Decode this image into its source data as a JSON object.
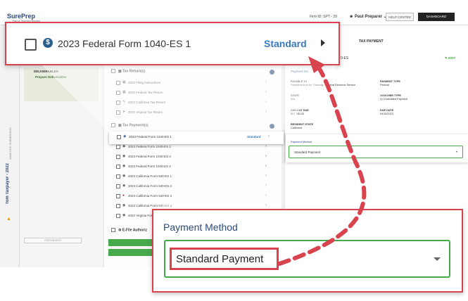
{
  "app": {
    "logo": "SurePrep",
    "logo_sub": "Part of Thomson Reuters",
    "firm_id": "Firm ID: SPT - 29",
    "user_name": "Paul Preparer",
    "help_center": "HELP CENTER",
    "dashboard": "DASHBOARD"
  },
  "left_panel": {
    "taxpayer": "Tom Taxpayer - 2022",
    "taxpayer_sub": "AWAITING SUBMISSION",
    "deliverables_title": "DELIVERABLES",
    "deliverables_sub": "Prepare Deliverables",
    "open_button": "OPEN BINDER"
  },
  "middle_panel": {
    "tax_returns_title": "Tax Return(s)",
    "tax_returns": [
      "2022 Filing Instructions",
      "2022 Federal Tax Return",
      "2022 California Tax Return",
      "2022 Virginia Tax Return"
    ],
    "tax_payments_title": "Tax Payment(s)",
    "tax_payments": [
      "2023 Federal Form 1040-ES 2",
      "2023 Federal Form 1040-ES 3",
      "2023 Federal Form 1040-ES 4",
      "2023 California Form 540-ES 1",
      "2023 California Form 540-ES 2",
      "2023 California Form 540-ES 3",
      "2023 California Form 540-ES 4",
      "2022 Virginia Form"
    ],
    "efile_title": "E-File Authoriz",
    "small_row_label": "2023 Federal Form 1040-ES 1",
    "small_row_type": "Standard"
  },
  "right_panel": {
    "tab": "TAX PAYMENT",
    "form_suffix": "0-ES",
    "edit": "EDIT",
    "payment_details": "Payment De",
    "payable_to_label": "PAYABLE TO",
    "payable_to": "Department of the Treasury - Internal Revenue Service",
    "payment_type_label": "PAYMENT TYPE",
    "payment_type": "Federal",
    "state_label": "STATE",
    "state": "N/A",
    "voucher_type_label": "VOUCHER TYPE",
    "voucher_type": "Q1 Estimated Payment",
    "amount_due_label": "AMOUNT DUE",
    "amount_due": "$57,760.00",
    "due_date_label": "DUE DATE",
    "due_date": "04/18/2023",
    "resident_state_label": "RESIDENT STATE",
    "resident_state": "California",
    "payment_method_label": "Payment Method",
    "payment_method_value": "Standard Payment"
  },
  "callout_top": {
    "form_label": "2023 Federal Form 1040-ES 1",
    "standard": "Standard"
  },
  "callout_bottom": {
    "title": "Payment Method",
    "value": "Standard Payment"
  },
  "colors": {
    "highlight_red": "#d9434e",
    "accent_green": "#46a94a",
    "link_blue": "#3a7ab8",
    "brand_navy": "#2a4a7a"
  }
}
